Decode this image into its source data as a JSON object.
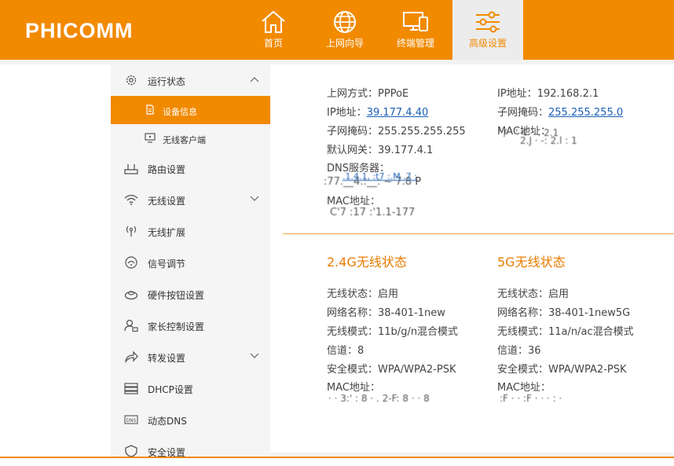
{
  "brand": "PHICOMM",
  "nav": [
    {
      "label": "首页"
    },
    {
      "label": "上网向导"
    },
    {
      "label": "终端管理"
    },
    {
      "label": "高级设置"
    }
  ],
  "sidebar": {
    "items": [
      {
        "label": "运行状态"
      },
      {
        "label": "设备信息"
      },
      {
        "label": "无线客户端"
      },
      {
        "label": "路由设置"
      },
      {
        "label": "无线设置"
      },
      {
        "label": "无线扩展"
      },
      {
        "label": "信号调节"
      },
      {
        "label": "硬件按钮设置"
      },
      {
        "label": "家长控制设置"
      },
      {
        "label": "转发设置"
      },
      {
        "label": "DHCP设置"
      },
      {
        "label": "动态DNS"
      },
      {
        "label": "安全设置"
      }
    ]
  },
  "wan": {
    "mode_label": "上网方式：",
    "mode_value": "PPPoE",
    "ip_label": "IP地址：",
    "ip_value": "39.177.4.40",
    "mask_label": "子网掩码：",
    "mask_value": "255.255.255.255",
    "gw_label": "默认网关：",
    "gw_value": "39.177.4.1",
    "dns_label": "DNS服务器：",
    "dns_value1": ":77.__4.:__: ~ 7.8",
    "dns_value2": "P",
    "mac_label": "MAC地址：",
    "mac_value": "C'7 :17 :'1.1-177",
    "dns_overlay": ".1.4.1, :t7 :.M .7 :"
  },
  "lan": {
    "ip_label": "IP地址：",
    "ip_value": "192.168.2.1",
    "mask_label": "子网掩码：",
    "mask_value": "255.255.255.0",
    "mac_label": "MAC地址：",
    "mac_value1": "' / ' ' 4 ` . 2.1",
    "mac_value2": "2.J  ·  -: 2.l  : 1"
  },
  "wifi24": {
    "title": "2.4G无线状态",
    "status_label": "无线状态：",
    "status_value": "启用",
    "ssid_label": "网络名称：",
    "ssid_value": "38-401-1new",
    "mode_label": "无线模式：",
    "mode_value": "11b/g/n混合模式",
    "channel_label": "信道：",
    "channel_value": "8",
    "security_label": "安全模式：",
    "security_value": "WPA/WPA2-PSK",
    "mac_label": "MAC地址：",
    "mac_value": "· · 3:' : 8 · . 2-F: 8 · · 8"
  },
  "wifi5": {
    "title": "5G无线状态",
    "status_label": "无线状态：",
    "status_value": "启用",
    "ssid_label": "网络名称：",
    "ssid_value": "38-401-1new5G",
    "mode_label": "无线模式：",
    "mode_value": "11a/n/ac混合模式",
    "channel_label": "信道：",
    "channel_value": "36",
    "security_label": "安全模式：",
    "security_value": "WPA/WPA2-PSK",
    "mac_label": "MAC地址：",
    "mac_value": ":F ·   · :F · ·  · :  ·"
  },
  "colors": {
    "accent": "#f28a00",
    "link": "#1a5fb4",
    "section_title": "#e87c00"
  }
}
